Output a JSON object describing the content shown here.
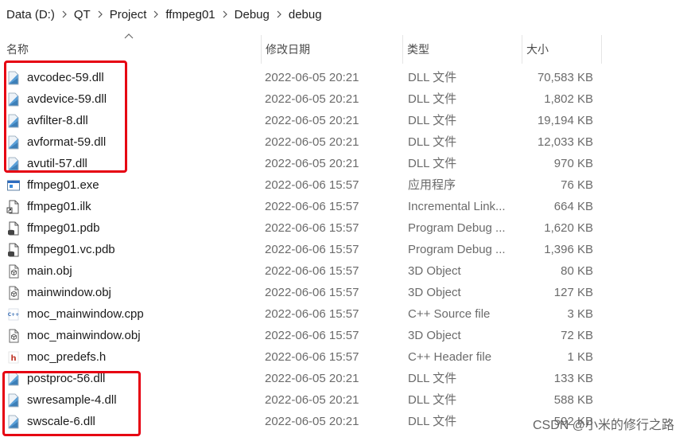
{
  "breadcrumb": [
    "Data (D:)",
    "QT",
    "Project",
    "ffmpeg01",
    "Debug",
    "debug"
  ],
  "columns": {
    "name": "名称",
    "date": "修改日期",
    "type": "类型",
    "size": "大小"
  },
  "files": [
    {
      "name": "avcodec-59.dll",
      "date": "2022-06-05 20:21",
      "type": "DLL 文件",
      "size": "70,583 KB",
      "icon": "dll-file-icon"
    },
    {
      "name": "avdevice-59.dll",
      "date": "2022-06-05 20:21",
      "type": "DLL 文件",
      "size": "1,802 KB",
      "icon": "dll-file-icon"
    },
    {
      "name": "avfilter-8.dll",
      "date": "2022-06-05 20:21",
      "type": "DLL 文件",
      "size": "19,194 KB",
      "icon": "dll-file-icon"
    },
    {
      "name": "avformat-59.dll",
      "date": "2022-06-05 20:21",
      "type": "DLL 文件",
      "size": "12,033 KB",
      "icon": "dll-file-icon"
    },
    {
      "name": "avutil-57.dll",
      "date": "2022-06-05 20:21",
      "type": "DLL 文件",
      "size": "970 KB",
      "icon": "dll-file-icon"
    },
    {
      "name": "ffmpeg01.exe",
      "date": "2022-06-06 15:57",
      "type": "应用程序",
      "size": "76 KB",
      "icon": "exe-file-icon"
    },
    {
      "name": "ffmpeg01.ilk",
      "date": "2022-06-06 15:57",
      "type": "Incremental Link...",
      "size": "664 KB",
      "icon": "ilk-file-icon"
    },
    {
      "name": "ffmpeg01.pdb",
      "date": "2022-06-06 15:57",
      "type": "Program Debug ...",
      "size": "1,620 KB",
      "icon": "pdb-file-icon"
    },
    {
      "name": "ffmpeg01.vc.pdb",
      "date": "2022-06-06 15:57",
      "type": "Program Debug ...",
      "size": "1,396 KB",
      "icon": "pdb-file-icon"
    },
    {
      "name": "main.obj",
      "date": "2022-06-06 15:57",
      "type": "3D Object",
      "size": "80 KB",
      "icon": "obj-file-icon"
    },
    {
      "name": "mainwindow.obj",
      "date": "2022-06-06 15:57",
      "type": "3D Object",
      "size": "127 KB",
      "icon": "obj-file-icon"
    },
    {
      "name": "moc_mainwindow.cpp",
      "date": "2022-06-06 15:57",
      "type": "C++ Source file",
      "size": "3 KB",
      "icon": "cpp-file-icon"
    },
    {
      "name": "moc_mainwindow.obj",
      "date": "2022-06-06 15:57",
      "type": "3D Object",
      "size": "72 KB",
      "icon": "obj-file-icon"
    },
    {
      "name": "moc_predefs.h",
      "date": "2022-06-06 15:57",
      "type": "C++ Header file",
      "size": "1 KB",
      "icon": "header-file-icon"
    },
    {
      "name": "postproc-56.dll",
      "date": "2022-06-05 20:21",
      "type": "DLL 文件",
      "size": "133 KB",
      "icon": "dll-file-icon"
    },
    {
      "name": "swresample-4.dll",
      "date": "2022-06-05 20:21",
      "type": "DLL 文件",
      "size": "588 KB",
      "icon": "dll-file-icon"
    },
    {
      "name": "swscale-6.dll",
      "date": "2022-06-05 20:21",
      "type": "DLL 文件",
      "size": "592 KB",
      "icon": "dll-file-icon"
    }
  ],
  "watermark": "CSDN @小米的修行之路",
  "colors": {
    "highlight": "#e60012",
    "header_text": "#4a4a4a",
    "detail_text": "#6b6b6b"
  }
}
